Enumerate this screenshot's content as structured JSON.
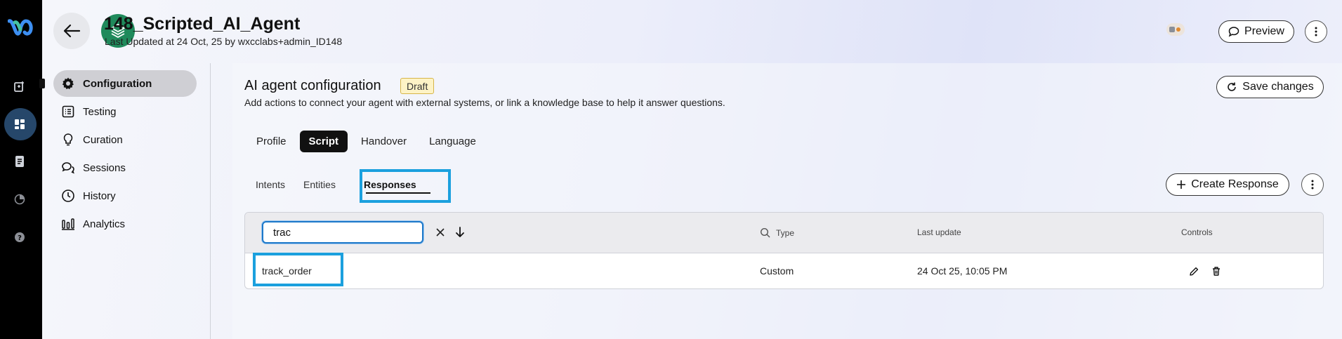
{
  "app": {
    "brand_icon": "webex-logo",
    "rail_icons": [
      "add-note-icon",
      "dashboard-icon",
      "document-icon",
      "pie-chart-icon",
      "help-icon"
    ]
  },
  "header": {
    "title": "148_Scripted_AI_Agent",
    "subtitle": "Last Updated at 24 Oct, 25 by wxcclabs+admin_ID148",
    "preview_label": "Preview"
  },
  "sidebar": {
    "items": [
      {
        "label": "Configuration",
        "icon": "gear-icon",
        "active": true
      },
      {
        "label": "Testing",
        "icon": "checklist-icon",
        "active": false
      },
      {
        "label": "Curation",
        "icon": "lightbulb-icon",
        "active": false
      },
      {
        "label": "Sessions",
        "icon": "chat-icon",
        "active": false
      },
      {
        "label": "History",
        "icon": "clock-icon",
        "active": false
      },
      {
        "label": "Analytics",
        "icon": "bar-chart-icon",
        "active": false
      }
    ]
  },
  "config": {
    "title": "AI agent configuration",
    "status_badge": "Draft",
    "description": "Add actions to connect your agent with external systems, or link a knowledge base to help it answer questions.",
    "save_label": "Save changes"
  },
  "tabs": {
    "primary": [
      "Profile",
      "Script",
      "Handover",
      "Language"
    ],
    "primary_active": "Script",
    "secondary": [
      "Intents",
      "Entities",
      "Responses"
    ],
    "secondary_active": "Responses"
  },
  "responses": {
    "create_label": "Create Response",
    "search_value": "trac",
    "columns": {
      "type": "Type",
      "last_update": "Last update",
      "controls": "Controls"
    },
    "rows": [
      {
        "name": "track_order",
        "type": "Custom",
        "last_update": "24 Oct 25, 10:05 PM"
      }
    ]
  },
  "colors": {
    "rail": "#000000",
    "accent_highlight": "#1ba0de",
    "agent_avatar": "#1f8a5b",
    "draft_badge_bg": "#fdf3c6"
  }
}
